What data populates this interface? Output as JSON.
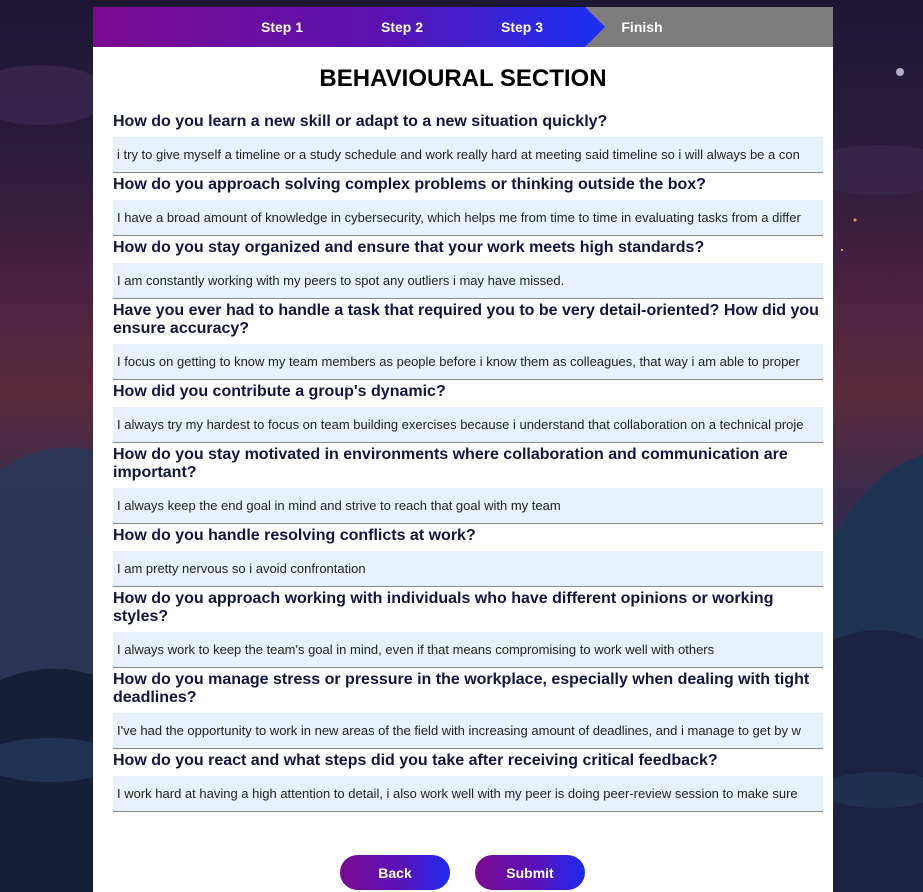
{
  "stepper": {
    "steps": [
      {
        "label": "Step 1",
        "state": "complete"
      },
      {
        "label": "Step 2",
        "state": "complete"
      },
      {
        "label": "Step 3",
        "state": "active"
      },
      {
        "label": "Finish",
        "state": "pending"
      }
    ],
    "colors": {
      "start": "#7b0a8f",
      "end": "#1a30f5",
      "pending": "#7c7c7c"
    }
  },
  "section": {
    "title": "BEHAVIOURAL SECTION"
  },
  "questions": [
    {
      "question": "How do you learn a new skill or adapt to a new situation quickly?",
      "answer": "i try to give myself a timeline or a study schedule and work really hard at meeting said timeline so i will always be a con"
    },
    {
      "question": "How do you approach solving complex problems or thinking outside the box?",
      "answer": "I have a broad amount of knowledge in cybersecurity, which helps me from time to time in evaluating tasks from a differ"
    },
    {
      "question": "How do you stay organized and ensure that your work meets high standards?",
      "answer": "I am constantly working with my peers to spot any outliers i may have missed."
    },
    {
      "question": "Have you ever had to handle a task that required you to be very detail-oriented? How did you ensure accuracy?",
      "answer": "I focus on getting to know my team members as people before i know them as colleagues, that way i am able to proper"
    },
    {
      "question": "How did you contribute a group's dynamic?",
      "answer": "I always try my hardest to focus on team building exercises because i understand that collaboration on a technical proje"
    },
    {
      "question": "How do you stay motivated in environments where collaboration and communication are important?",
      "answer": "I always keep the end goal in mind and strive to reach that goal with my team"
    },
    {
      "question": "How do you handle resolving conflicts at work?",
      "answer": "I am pretty nervous so i avoid confrontation"
    },
    {
      "question": "How do you approach working with individuals who have different opinions or working styles?",
      "answer": "I always work to keep the team's goal in mind, even if that means compromising to work well with others"
    },
    {
      "question": "How do you manage stress or pressure in the workplace, especially when dealing with tight deadlines?",
      "answer": "I've had the opportunity to work in new areas of the field with increasing amount of deadlines, and i manage to get by w"
    },
    {
      "question": "How do you react and what steps did you take after receiving critical feedback?",
      "answer": "I work hard at having a high attention to detail, i also work well with my peer is doing peer-review session to make sure"
    }
  ],
  "buttons": {
    "back": "Back",
    "submit": "Submit"
  }
}
